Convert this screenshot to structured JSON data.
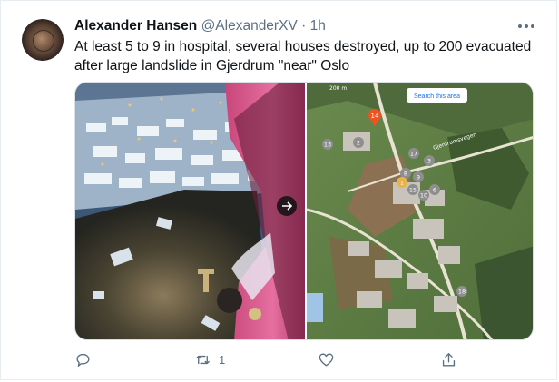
{
  "tweet": {
    "author_name": "Alexander Hansen",
    "handle": "@AlexanderXV",
    "separator": "·",
    "time": "1h",
    "text": "At least 5 to 9 in hospital, several houses destroyed, up to 200 evacuated after large landslide in Gjerdrum \"near\" Oslo"
  },
  "map": {
    "search_button": "Search this area",
    "scale_label": "200 m",
    "road_label": "Gjerdrumsvegen",
    "selected_pin": "14",
    "pins": [
      "13",
      "2",
      "17",
      "3",
      "8",
      "9",
      "1",
      "15",
      "10",
      "6",
      "18"
    ]
  },
  "actions": {
    "reply_count": "",
    "retweet_count": "1",
    "like_count": ""
  },
  "icons": {
    "more": "more-dots-icon",
    "reply": "reply-icon",
    "retweet": "retweet-icon",
    "like": "heart-icon",
    "share": "share-icon",
    "next": "arrow-right-icon"
  },
  "colors": {
    "secondary_text": "#5b7083",
    "pin_selected": "#f4511e",
    "pin_default": "#8e8e8e"
  }
}
